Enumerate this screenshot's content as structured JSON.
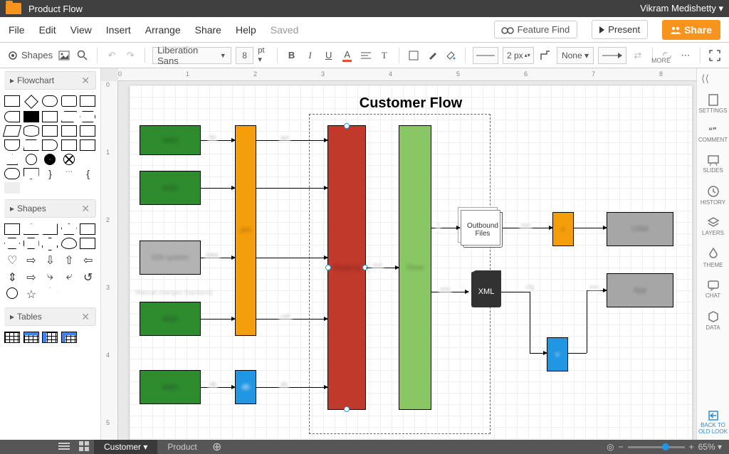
{
  "titlebar": {
    "doc_title": "Product Flow",
    "user": "Vikram Medishetty ▾"
  },
  "menu": {
    "file": "File",
    "edit": "Edit",
    "view": "View",
    "insert": "Insert",
    "arrange": "Arrange",
    "share_menu": "Share",
    "help": "Help",
    "saved": "Saved",
    "feature_find": "Feature Find",
    "present": "Present",
    "share_btn": "Share"
  },
  "toolbar": {
    "shapes": "Shapes",
    "font": "Liberation Sans",
    "font_size": "8",
    "font_unit": "pt ▾",
    "stroke": "2 px",
    "fill": "None ▾",
    "more": "MORE"
  },
  "left": {
    "sections": [
      {
        "title": "Flowchart"
      },
      {
        "title": "Shapes"
      },
      {
        "title": "Tables"
      }
    ]
  },
  "ruler_h": [
    "0",
    "1",
    "2",
    "3",
    "4",
    "5",
    "6",
    "7",
    "8"
  ],
  "ruler_v": [
    "0",
    "1",
    "2",
    "3",
    "4",
    "5"
  ],
  "diagram": {
    "title": "Customer Flow",
    "outbound": "Outbound Files",
    "xml": "XML"
  },
  "right": {
    "settings": "SETTINGS",
    "comment": "COMMENT",
    "slides": "SLIDES",
    "history": "HISTORY",
    "layers": "LAYERS",
    "theme": "THEME",
    "chat": "CHAT",
    "data": "DATA",
    "back": "BACK TO OLD LOOK"
  },
  "tabs": {
    "customer": "Customer ▾",
    "product": "Product",
    "zoom": "65% ▾"
  }
}
